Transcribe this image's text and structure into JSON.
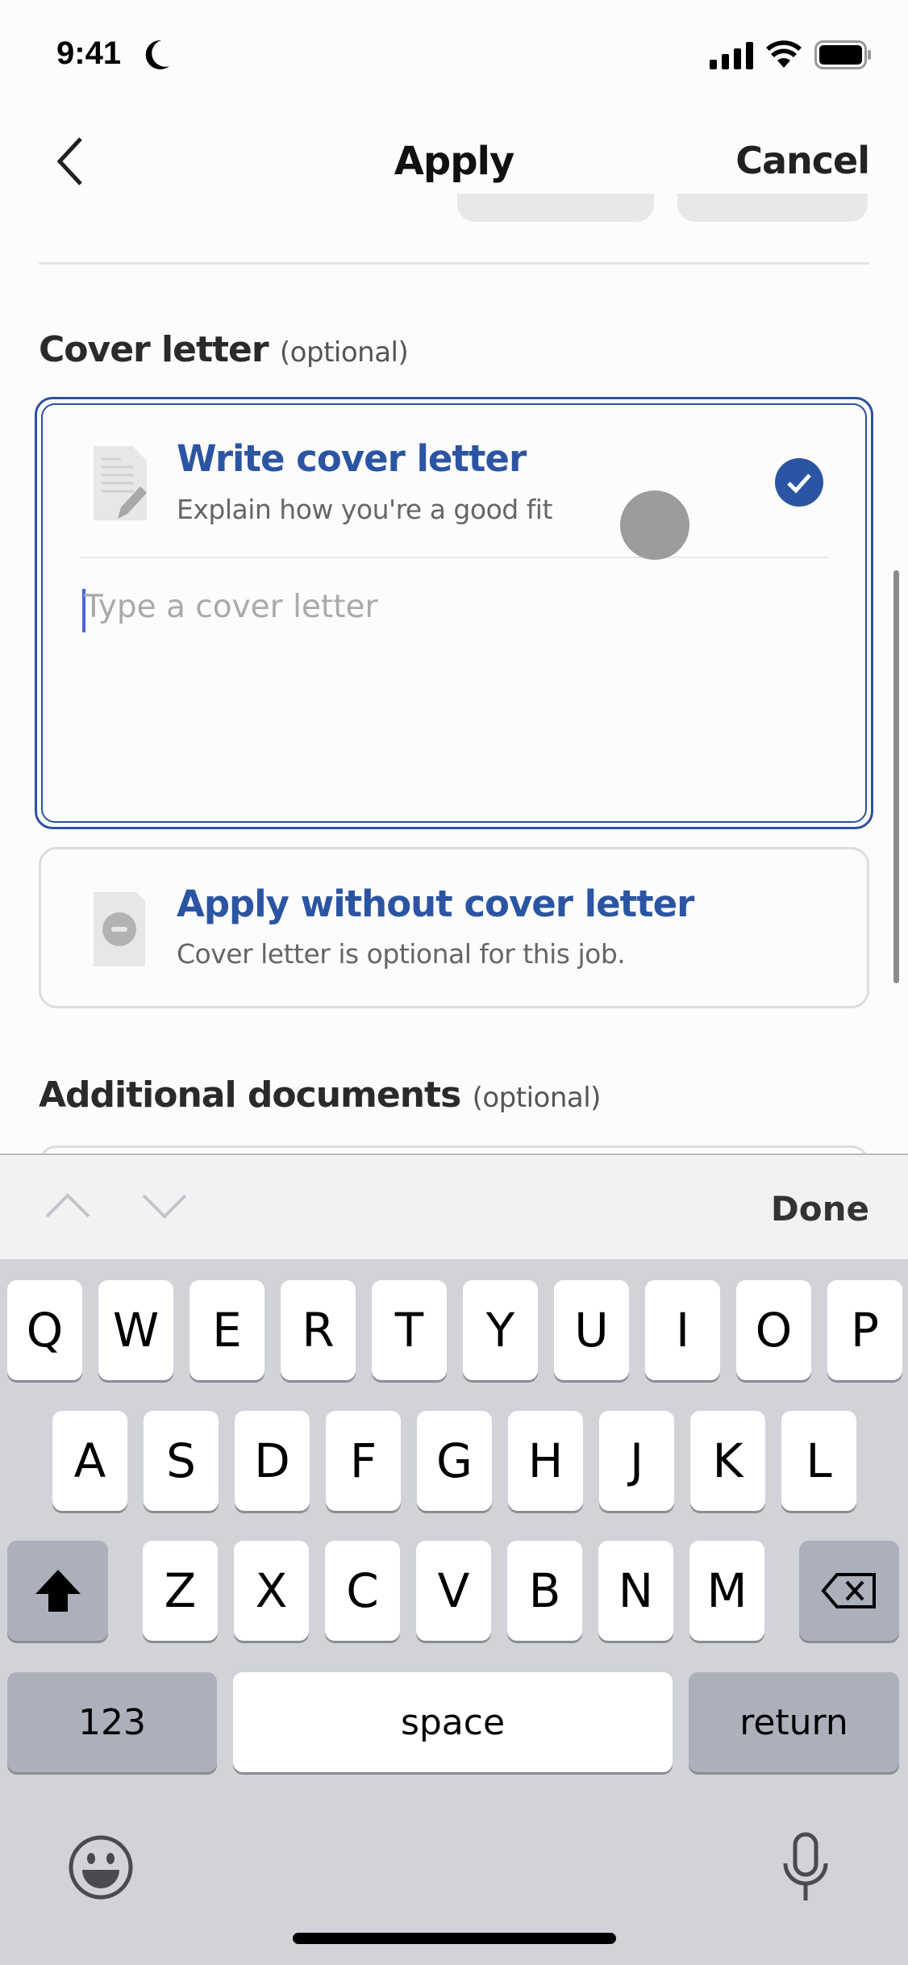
{
  "status_bar": {
    "time": "9:41",
    "icons": [
      "moon-icon",
      "signal-icon",
      "wifi-icon",
      "battery-icon"
    ]
  },
  "nav": {
    "title": "Apply",
    "cancel": "Cancel",
    "back_icon": "chevron-left-icon"
  },
  "cover_letter": {
    "heading": "Cover letter",
    "optional": "(optional)",
    "write": {
      "title": "Write cover letter",
      "subtitle": "Explain how you're a good fit",
      "placeholder": "Type a cover letter",
      "selected": true
    },
    "without": {
      "title": "Apply without cover letter",
      "subtitle": "Cover letter is optional for this job.",
      "selected": false
    }
  },
  "additional": {
    "heading": "Additional documents",
    "optional": "(optional)"
  },
  "keyboard": {
    "done": "Done",
    "row1": [
      "Q",
      "W",
      "E",
      "R",
      "T",
      "Y",
      "U",
      "I",
      "O",
      "P"
    ],
    "row2": [
      "A",
      "S",
      "D",
      "F",
      "G",
      "H",
      "J",
      "K",
      "L"
    ],
    "row3": [
      "Z",
      "X",
      "C",
      "V",
      "B",
      "N",
      "M"
    ],
    "numbers": "123",
    "space": "space",
    "return": "return"
  },
  "colors": {
    "accent": "#2b55a3",
    "keyboard_bg": "#d1d3d9"
  }
}
